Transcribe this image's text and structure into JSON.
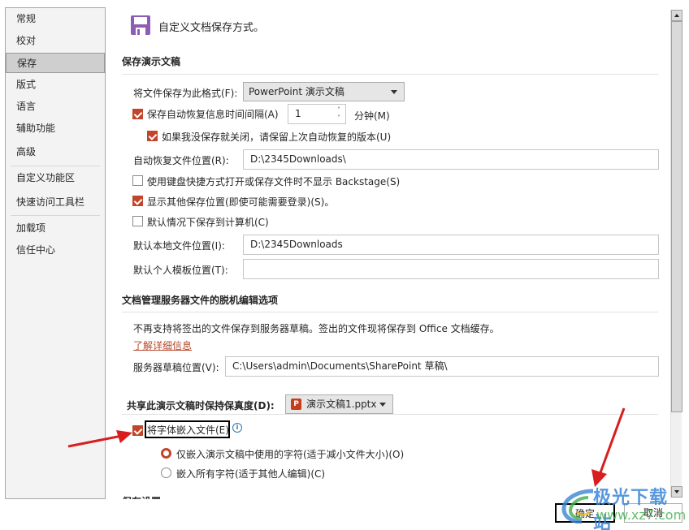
{
  "sidebar": {
    "items": [
      {
        "label": "常规",
        "active": false
      },
      {
        "label": "校对",
        "active": false
      },
      {
        "label": "保存",
        "active": true
      },
      {
        "label": "版式",
        "active": false
      },
      {
        "label": "语言",
        "active": false
      },
      {
        "label": "辅助功能",
        "active": false
      },
      {
        "label": "高级",
        "active": false
      },
      {
        "label": "自定义功能区",
        "active": false
      },
      {
        "label": "快速访问工具栏",
        "active": false
      },
      {
        "label": "加载项",
        "active": false
      },
      {
        "label": "信任中心",
        "active": false
      }
    ]
  },
  "header": {
    "icon": "floppy-disk-icon",
    "text": "自定义文档保存方式。"
  },
  "save_presentations": {
    "title": "保存演示文稿",
    "format_label": "将文件保存为此格式(F):",
    "format_value": "PowerPoint 演示文稿",
    "autorecover_label": "保存自动恢复信息时间间隔(A)",
    "autorecover_checked": true,
    "autorecover_minutes": "1",
    "minutes_label": "分钟(M)",
    "keep_last_label": "如果我没保存就关闭，请保留上次自动恢复的版本(U)",
    "keep_last_checked": true,
    "autorecover_location_label": "自动恢复文件位置(R):",
    "autorecover_location_value": "D:\\2345Downloads\\",
    "backstage_label": "使用键盘快捷方式打开或保存文件时不显示 Backstage(S)",
    "backstage_checked": false,
    "show_other_label": "显示其他保存位置(即使可能需要登录)(S)。",
    "show_other_checked": true,
    "save_to_computer_label": "默认情况下保存到计算机(C)",
    "save_to_computer_checked": false,
    "default_local_label": "默认本地文件位置(I):",
    "default_local_value": "D:\\2345Downloads",
    "default_template_label": "默认个人模板位置(T):",
    "default_template_value": ""
  },
  "offline_editing": {
    "title": "文档管理服务器文件的脱机编辑选项",
    "notice": "不再支持将签出的文件保存到服务器草稿。签出的文件现将保存到 Office 文档缓存。",
    "learn_more": "了解详细信息",
    "drafts_label": "服务器草稿位置(V):",
    "drafts_value": "C:\\Users\\admin\\Documents\\SharePoint 草稿\\"
  },
  "fidelity": {
    "title": "共享此演示文稿时保持保真度(D):",
    "file_value": "演示文稿1.pptx",
    "file_icon": "powerpoint-file-icon",
    "embed_fonts_label": "将字体嵌入文件(E)",
    "embed_fonts_checked": true,
    "info_icon": "i",
    "option_used_label": "仅嵌入演示文稿中使用的字符(适于减小文件大小)(O)",
    "option_used_selected": true,
    "option_all_label": "嵌入所有字符(适于其他人编辑)(C)",
    "option_all_selected": false
  },
  "next_section": {
    "title": "保存设置"
  },
  "buttons": {
    "ok": "确定",
    "cancel": "取消"
  },
  "watermark": {
    "text": "极光下载站",
    "url": "www.xz7.com"
  },
  "colors": {
    "accent": "#c0452a",
    "link": "#b7472a",
    "annotation_arrow": "#d81e1e",
    "header_icon": "#8e5bb5"
  }
}
